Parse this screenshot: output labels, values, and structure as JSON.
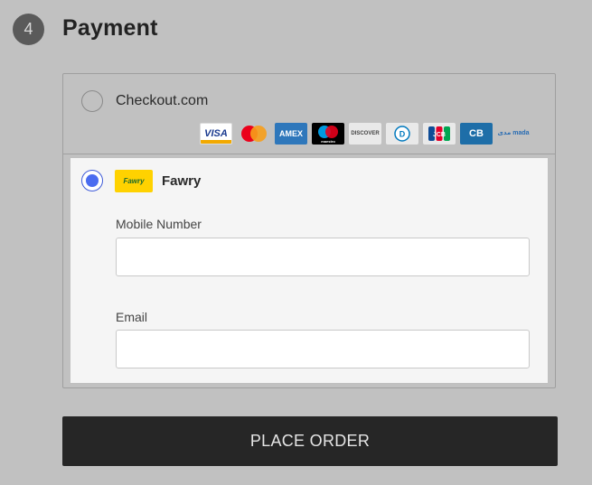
{
  "step": {
    "number": "4",
    "title": "Payment"
  },
  "payment_methods": [
    {
      "label": "Checkout.com",
      "selected": false
    },
    {
      "label": "Fawry",
      "selected": true,
      "logo_text": "Fawry"
    }
  ],
  "card_logos": [
    {
      "name": "visa",
      "text": "VISA"
    },
    {
      "name": "mastercard",
      "text": ""
    },
    {
      "name": "amex",
      "text": "AMEX"
    },
    {
      "name": "maestro",
      "text": "maestro"
    },
    {
      "name": "discover",
      "text": "DISCOVER"
    },
    {
      "name": "diners",
      "text": "D"
    },
    {
      "name": "jcb",
      "text": "JCB"
    },
    {
      "name": "cb",
      "text": "CB"
    },
    {
      "name": "mada",
      "text": "مدى mada"
    }
  ],
  "fawry_form": {
    "mobile_label": "Mobile Number",
    "mobile_value": "",
    "email_label": "Email",
    "email_value": ""
  },
  "place_order_label": "PLACE ORDER"
}
